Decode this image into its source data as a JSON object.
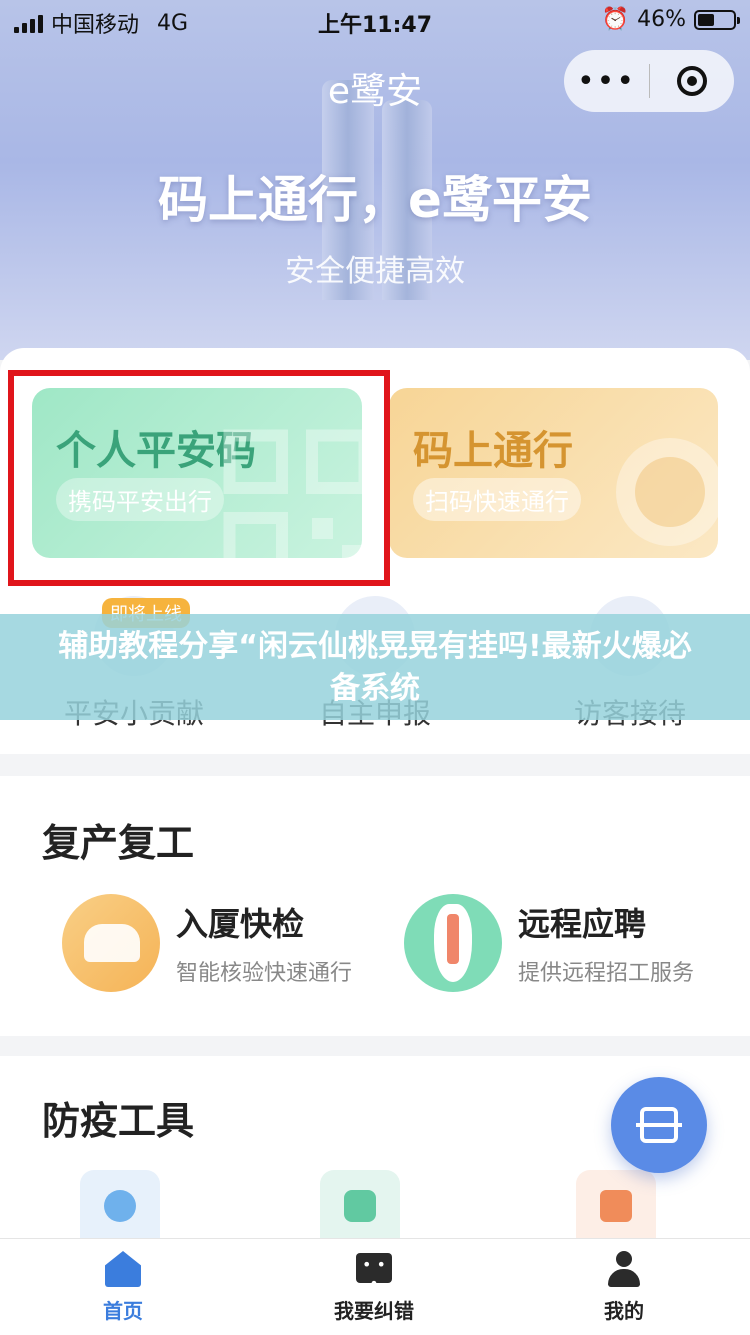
{
  "status_bar": {
    "carrier": "中国移动",
    "network": "4G",
    "time": "上午11:47",
    "battery": "46%",
    "battery_level": 0.46
  },
  "nav": {
    "title": "e鹭安",
    "more_label": "•••"
  },
  "hero": {
    "title": "码上通行，e鹭平安",
    "subtitle": "安全便捷高效"
  },
  "cards": [
    {
      "title": "个人平安码",
      "tag": "携码平安出行"
    },
    {
      "title": "码上通行",
      "tag": "扫码快速通行"
    }
  ],
  "quick_actions": [
    {
      "label": "平安小贡献",
      "badge": "即将上线"
    },
    {
      "label": "自主申报"
    },
    {
      "label": "访客接待"
    }
  ],
  "overlay_text": "辅助教程分享“闲云仙桃晃晃有挂吗!最新火爆必备系统",
  "sections": {
    "resume_work": {
      "title": "复产复工",
      "items": [
        {
          "title": "入厦快检",
          "desc": "智能核验快速通行"
        },
        {
          "title": "远程应聘",
          "desc": "提供远程招工服务"
        }
      ]
    },
    "tools": {
      "title": "防疫工具"
    }
  },
  "tabbar": [
    {
      "label": "首页",
      "icon": "home-icon",
      "active": true
    },
    {
      "label": "我要纠错",
      "icon": "message-icon"
    },
    {
      "label": "我的",
      "icon": "user-icon"
    }
  ],
  "colors": {
    "accent": "#3b7ddd",
    "highlight": "#e0151b",
    "green_card": "#9fe7c6",
    "orange_card": "#f7d596"
  }
}
